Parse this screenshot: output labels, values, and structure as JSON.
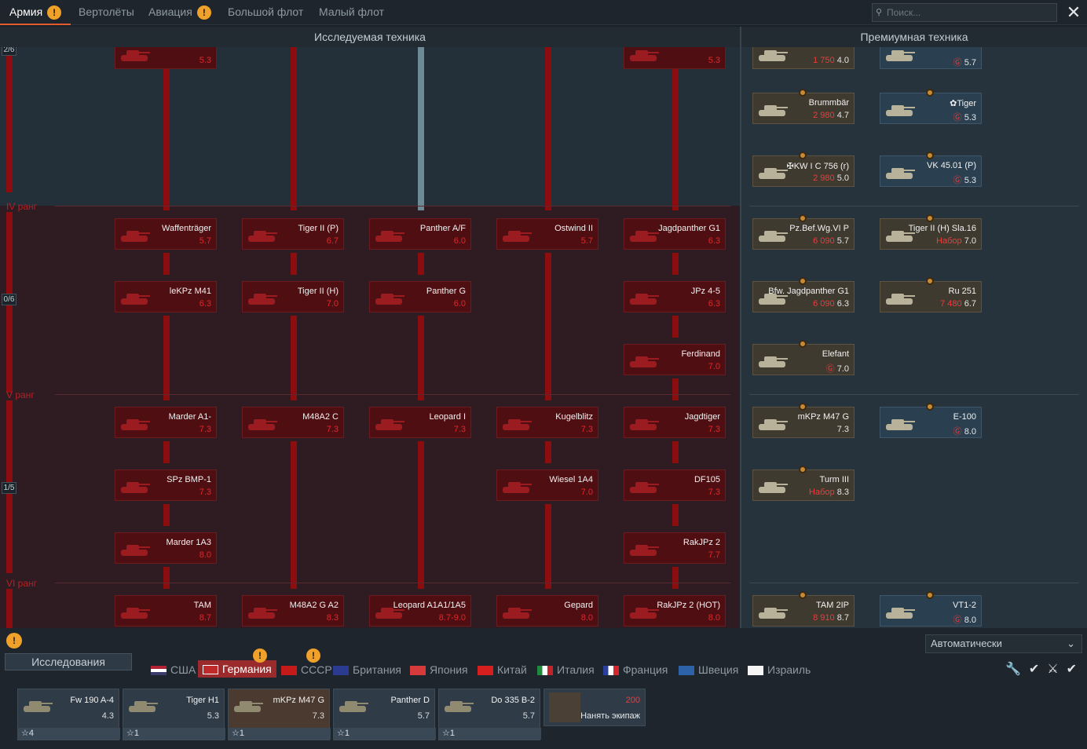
{
  "top_tabs": [
    {
      "label": "Армия",
      "warn": "!"
    },
    {
      "label": "Вертолёты"
    },
    {
      "label": "Авиация",
      "warn": "!"
    },
    {
      "label": "Большой флот"
    },
    {
      "label": "Малый флот"
    }
  ],
  "search": {
    "placeholder": "Поиск..."
  },
  "close": "✕",
  "headers": {
    "research": "Исследуемая техника",
    "premium": "Премиумная техника"
  },
  "ranks": [
    "IV ранг",
    "V ранг",
    "VI ранг"
  ],
  "rank_counts": [
    "2/6",
    "0/6",
    "1/5"
  ],
  "tree_cards": [
    {
      "name": "",
      "br": "5.3"
    },
    {
      "name": "",
      "br": "5.3"
    },
    {
      "name": "Waffenträger",
      "br": "5.7"
    },
    {
      "name": "Tiger II (P)",
      "br": "6.7"
    },
    {
      "name": "Panther A/F",
      "br": "6.0"
    },
    {
      "name": "Ostwind II",
      "br": "5.7"
    },
    {
      "name": "Jagdpanther G1",
      "br": "6.3"
    },
    {
      "name": "leKPz M41",
      "br": "6.3"
    },
    {
      "name": "Tiger II (H)",
      "br": "7.0"
    },
    {
      "name": "Panther G",
      "br": "6.0"
    },
    {
      "name": "JPz 4-5",
      "br": "6.3"
    },
    {
      "name": "Ferdinand",
      "br": "7.0"
    },
    {
      "name": "Marder A1-",
      "br": "7.3"
    },
    {
      "name": "M48A2 C",
      "br": "7.3"
    },
    {
      "name": "Leopard I",
      "br": "7.3"
    },
    {
      "name": "Kugelblitz",
      "br": "7.3"
    },
    {
      "name": "Jagdtiger",
      "br": "7.3"
    },
    {
      "name": "SPz BMP-1",
      "br": "7.3"
    },
    {
      "name": "Wiesel 1A4",
      "br": "7.0"
    },
    {
      "name": "DF105",
      "br": "7.3"
    },
    {
      "name": "Marder 1A3",
      "br": "8.0"
    },
    {
      "name": "RakJPz 2",
      "br": "7.7"
    },
    {
      "name": "TAM",
      "br": "8.7"
    },
    {
      "name": "M48A2 G A2",
      "br": "8.3"
    },
    {
      "name": "Leopard A1A1/1A5",
      "br": "8.7-9.0"
    },
    {
      "name": "Gepard",
      "br": "8.0"
    },
    {
      "name": "RakJPz 2 (HOT)",
      "br": "8.0"
    }
  ],
  "premium_cards": [
    {
      "name": "",
      "price": "1 750",
      "br": "4.0"
    },
    {
      "name": "",
      "price": "Ⓖ",
      "br": "5.7"
    },
    {
      "name": "Brummbär",
      "price": "2 980",
      "br": "4.7"
    },
    {
      "name": "✿Tiger",
      "price": "Ⓖ",
      "br": "5.3"
    },
    {
      "name": "✠KW I C 756 (r)",
      "price": "2 980",
      "br": "5.0"
    },
    {
      "name": "VK 45.01 (P)",
      "price": "Ⓖ",
      "br": "5.3"
    },
    {
      "name": "Pz.Bef.Wg.VI P",
      "price": "6 090",
      "br": "5.7"
    },
    {
      "name": "Tiger II (H) Sla.16",
      "price": "Набор",
      "br": "7.0"
    },
    {
      "name": "Bfw. Jagdpanther G1",
      "price": "6 090",
      "br": "6.3"
    },
    {
      "name": "Ru 251",
      "price": "7 480",
      "br": "6.7"
    },
    {
      "name": "Elefant",
      "price": "Ⓖ",
      "br": "7.0"
    },
    {
      "name": "mKPz M47 G",
      "price": "",
      "br": "7.3"
    },
    {
      "name": "E-100",
      "price": "Ⓖ",
      "br": "8.0"
    },
    {
      "name": "Turm III",
      "price": "Набор",
      "br": "8.3"
    },
    {
      "name": "TAM 2IP",
      "price": "8 910",
      "br": "8.7"
    },
    {
      "name": "VT1-2",
      "price": "Ⓖ",
      "br": "8.0"
    }
  ],
  "bottom": {
    "research_label": "Исследования",
    "mode_select": "Автоматически",
    "nations": [
      "США",
      "Германия",
      "СССР",
      "Британия",
      "Япония",
      "Китай",
      "Италия",
      "Франция",
      "Швеция",
      "Израиль"
    ],
    "nation_warns": [
      "!",
      "!"
    ],
    "slots": [
      {
        "name": "Fw 190 A-4",
        "br": "4.3",
        "crew": "4"
      },
      {
        "name": "Tiger H1",
        "br": "5.3",
        "crew": "1"
      },
      {
        "name": "mKPz M47 G",
        "br": "7.3",
        "crew": "1"
      },
      {
        "name": "Panther D",
        "br": "5.7",
        "crew": "1"
      },
      {
        "name": "Do 335 B-2",
        "br": "5.7",
        "crew": "1"
      }
    ],
    "hire": {
      "price": "200",
      "label": "Нанять экипаж"
    }
  },
  "colors": {
    "accent": "#e25b2d",
    "tree_line": "#8b0d10",
    "card_red": "#4f0e12",
    "premium_gold": "#3f3a30",
    "active_nation": "#9b2a2c"
  }
}
